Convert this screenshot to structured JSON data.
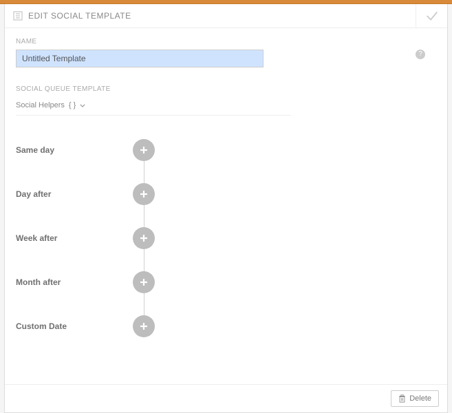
{
  "header": {
    "title": "EDIT SOCIAL TEMPLATE"
  },
  "name": {
    "label": "NAME",
    "value": "Untitled Template"
  },
  "queue": {
    "label": "SOCIAL QUEUE TEMPLATE",
    "helpers_label": "Social Helpers",
    "helpers_braces": "{ }",
    "rows": [
      {
        "label": "Same day"
      },
      {
        "label": "Day after"
      },
      {
        "label": "Week after"
      },
      {
        "label": "Month after"
      },
      {
        "label": "Custom Date"
      }
    ]
  },
  "footer": {
    "delete_label": "Delete"
  },
  "colors": {
    "accent": "#d88a3a",
    "node": "#bdbdbd"
  }
}
